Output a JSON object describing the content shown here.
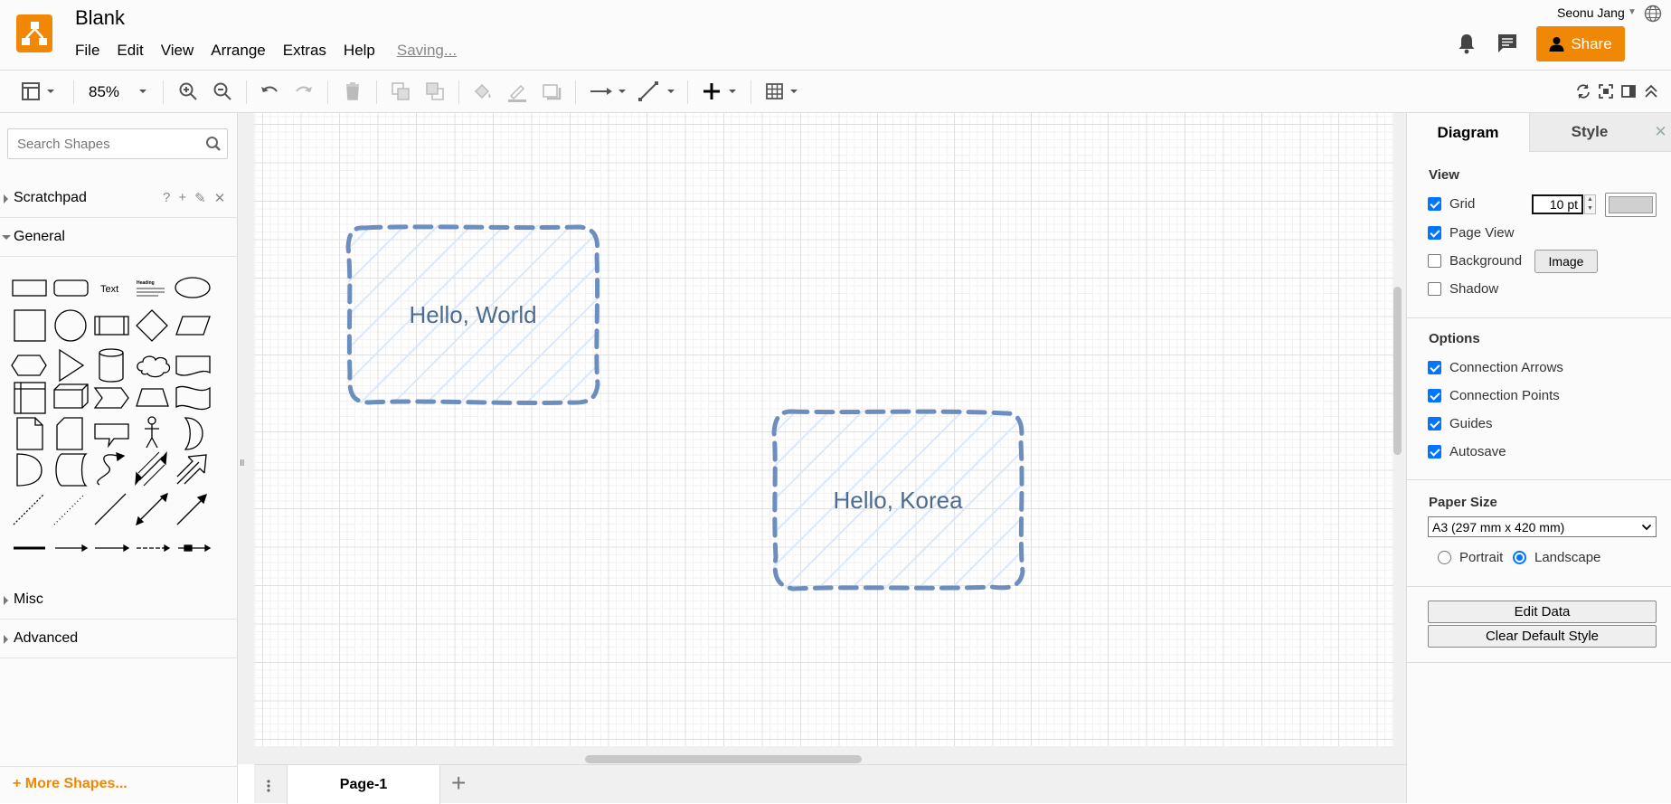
{
  "app": {
    "title": "Blank",
    "saving_status": "Saving..."
  },
  "menu": [
    "File",
    "Edit",
    "View",
    "Arrange",
    "Extras",
    "Help"
  ],
  "user": {
    "name": "Seonu Jang"
  },
  "share_label": "Share",
  "toolbar": {
    "zoom": "85%"
  },
  "sidebar": {
    "search_placeholder": "Search Shapes",
    "scratchpad": "Scratchpad",
    "scratchpad_help": "?",
    "general": "General",
    "misc": "Misc",
    "advanced": "Advanced",
    "more_shapes": "+ More Shapes...",
    "shape_text_label": "Text",
    "shape_heading_label": "Heading"
  },
  "canvas": {
    "shapes": [
      {
        "label": "Hello, World"
      },
      {
        "label": "Hello, Korea"
      }
    ],
    "fill_color": "#dae8fc",
    "stroke_color": "#6c8ebf"
  },
  "pages": {
    "current": "Page-1"
  },
  "format_panel": {
    "tabs": [
      "Diagram",
      "Style"
    ],
    "view_title": "View",
    "grid": {
      "label": "Grid",
      "checked": true,
      "size": "10 pt"
    },
    "page_view": {
      "label": "Page View",
      "checked": true
    },
    "background": {
      "label": "Background",
      "checked": false,
      "button": "Image"
    },
    "shadow": {
      "label": "Shadow",
      "checked": false
    },
    "options_title": "Options",
    "options": [
      {
        "label": "Connection Arrows",
        "checked": true
      },
      {
        "label": "Connection Points",
        "checked": true
      },
      {
        "label": "Guides",
        "checked": true
      },
      {
        "label": "Autosave",
        "checked": true
      }
    ],
    "paper_size_title": "Paper Size",
    "paper_size": "A3 (297 mm x 420 mm)",
    "orientation": {
      "portrait": "Portrait",
      "landscape": "Landscape",
      "selected": "landscape"
    },
    "edit_data": "Edit Data",
    "clear_default_style": "Clear Default Style"
  },
  "colors": {
    "accent": "#f08705",
    "checkbox": "#0075ff"
  }
}
